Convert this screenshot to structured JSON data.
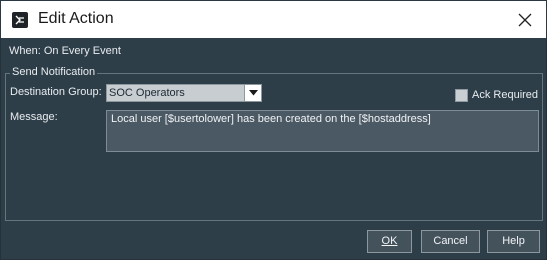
{
  "window": {
    "title": "Edit Action",
    "app_icon": "app-logo-icon",
    "close_icon": "close-icon"
  },
  "when": "When: On Every Event",
  "send_notification": {
    "legend": "Send Notification",
    "destination_label": "Destination Group:",
    "destination_value": "SOC Operators",
    "dropdown_icon": "chevron-down-icon",
    "ack_label": "Ack Required",
    "ack_checked": false,
    "message_label": "Message:",
    "message_value": "Local user [$usertolower] has been created on the [$hostaddress]"
  },
  "buttons": {
    "ok": "OK",
    "cancel": "Cancel",
    "help": "Help"
  },
  "colors": {
    "body_bg": "#2e3e49",
    "titlebar_bg": "#ffffff",
    "field_bg": "#4a5964",
    "button_bg": "#44525c"
  }
}
